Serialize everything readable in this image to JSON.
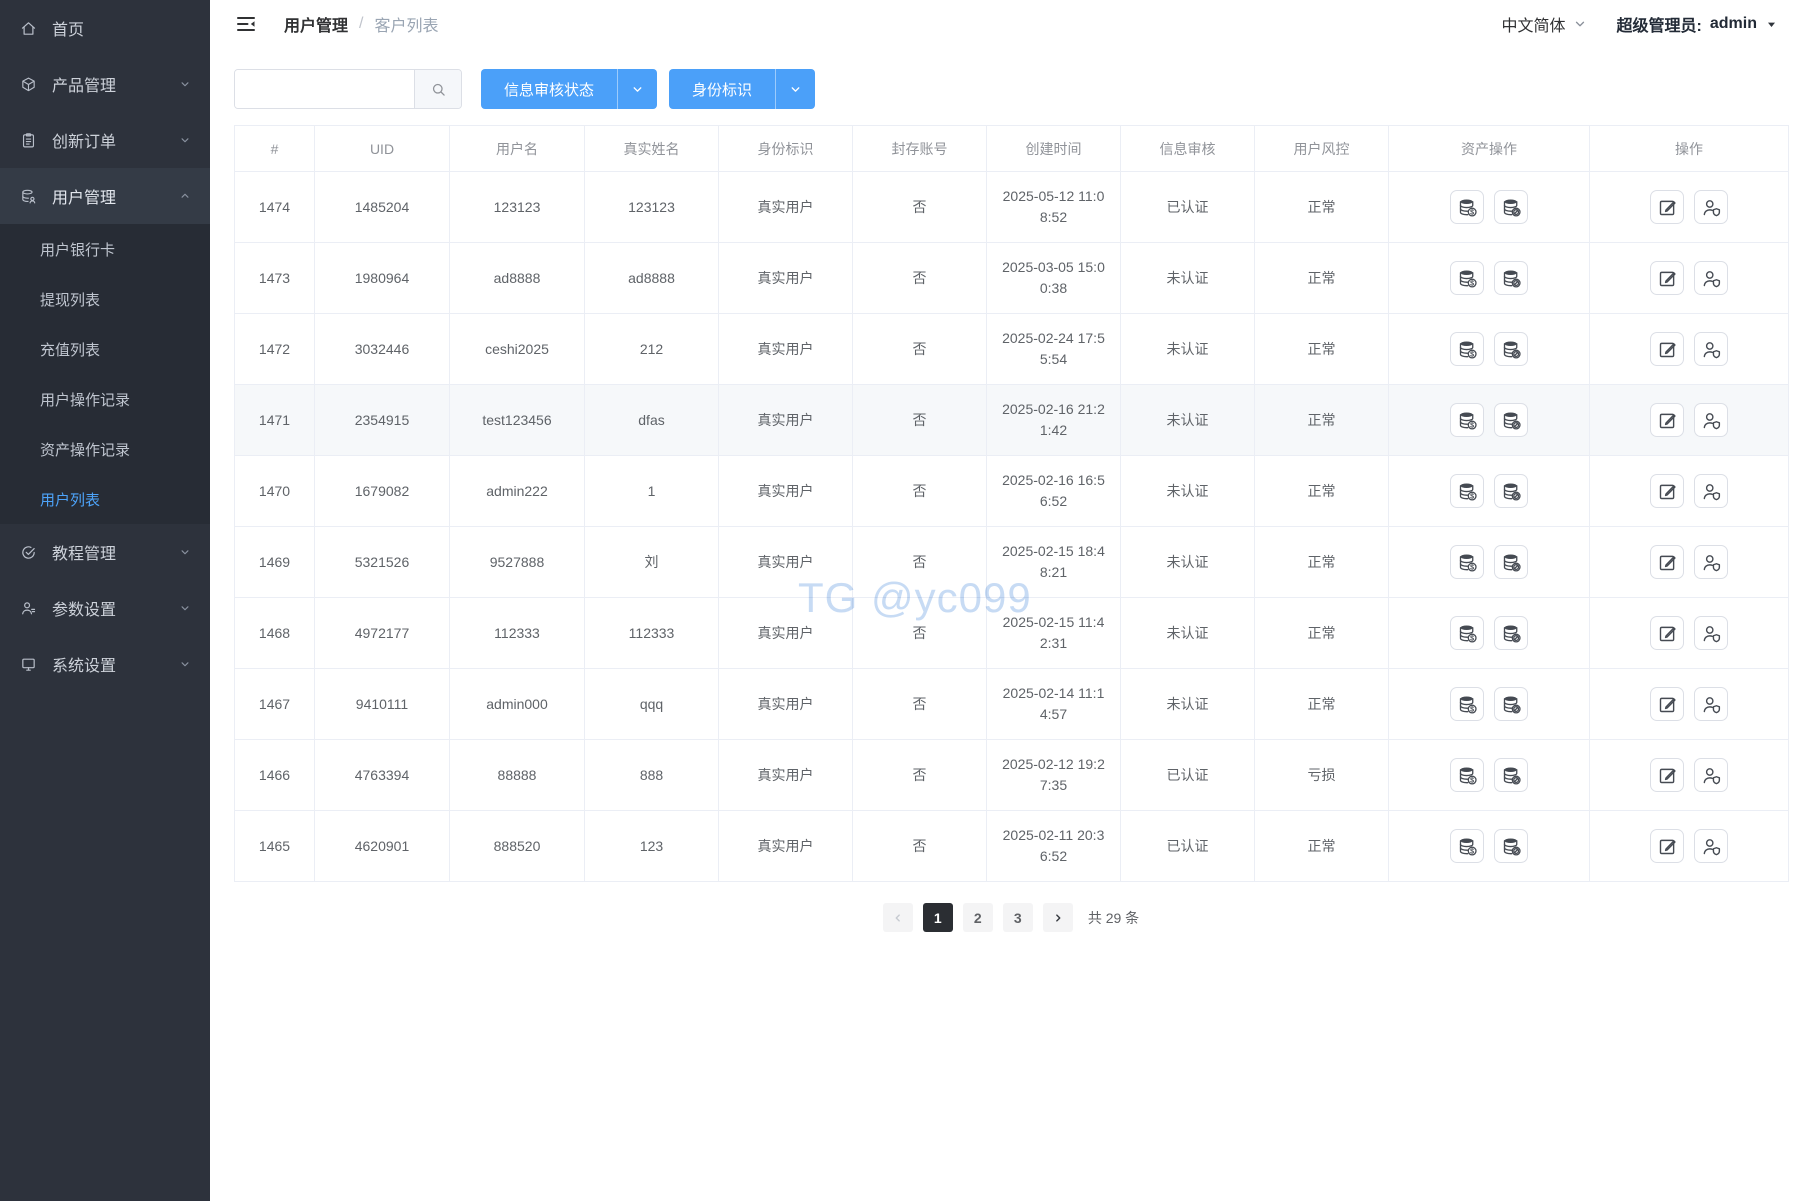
{
  "sidebar": {
    "items": [
      {
        "name": "home",
        "label": "首页",
        "icon": "home-icon",
        "chevron": null
      },
      {
        "name": "products",
        "label": "产品管理",
        "icon": "product-icon",
        "chevron": "down"
      },
      {
        "name": "innovation-orders",
        "label": "创新订单",
        "icon": "order-icon",
        "chevron": "down"
      },
      {
        "name": "user-management",
        "label": "用户管理",
        "icon": "users-icon",
        "chevron": "up",
        "expanded": true,
        "children": [
          {
            "name": "user-bank-cards",
            "label": "用户银行卡",
            "active": false
          },
          {
            "name": "withdraw-list",
            "label": "提现列表",
            "active": false
          },
          {
            "name": "recharge-list",
            "label": "充值列表",
            "active": false
          },
          {
            "name": "user-operation-records",
            "label": "用户操作记录",
            "active": false
          },
          {
            "name": "asset-operation-records",
            "label": "资产操作记录",
            "active": false
          },
          {
            "name": "user-list",
            "label": "用户列表",
            "active": true
          }
        ]
      },
      {
        "name": "tutorials",
        "label": "教程管理",
        "icon": "tutorial-icon",
        "chevron": "down"
      },
      {
        "name": "parameters",
        "label": "参数设置",
        "icon": "params-icon",
        "chevron": "down"
      },
      {
        "name": "system-settings",
        "label": "系统设置",
        "icon": "system-icon",
        "chevron": "down"
      }
    ]
  },
  "header": {
    "breadcrumb": [
      "用户管理",
      "客户列表"
    ],
    "language": "中文简体",
    "user_role_label": "超级管理员:",
    "username": "admin"
  },
  "toolbar": {
    "search_placeholder": "",
    "search_value": "",
    "filters": [
      {
        "label": "信息审核状态"
      },
      {
        "label": "身份标识"
      }
    ]
  },
  "table": {
    "columns": [
      "#",
      "UID",
      "用户名",
      "真实姓名",
      "身份标识",
      "封存账号",
      "创建时间",
      "信息审核",
      "用户风控",
      "资产操作",
      "操作"
    ],
    "asset_action_icons": [
      "coins-dollar-icon",
      "coins-ban-icon"
    ],
    "row_action_icons": [
      "edit-icon",
      "user-shield-icon"
    ],
    "rows": [
      {
        "id": "1474",
        "uid": "1485204",
        "username": "123123",
        "real_name": "123123",
        "identity": "真实用户",
        "sealed": "否",
        "created_at": "2025-05-12 11:08:52",
        "review": "已认证",
        "risk": "正常",
        "highlighted": false
      },
      {
        "id": "1473",
        "uid": "1980964",
        "username": "ad8888",
        "real_name": "ad8888",
        "identity": "真实用户",
        "sealed": "否",
        "created_at": "2025-03-05 15:00:38",
        "review": "未认证",
        "risk": "正常",
        "highlighted": false
      },
      {
        "id": "1472",
        "uid": "3032446",
        "username": "ceshi2025",
        "real_name": "212",
        "identity": "真实用户",
        "sealed": "否",
        "created_at": "2025-02-24 17:55:54",
        "review": "未认证",
        "risk": "正常",
        "highlighted": false
      },
      {
        "id": "1471",
        "uid": "2354915",
        "username": "test123456",
        "real_name": "dfas",
        "identity": "真实用户",
        "sealed": "否",
        "created_at": "2025-02-16 21:21:42",
        "review": "未认证",
        "risk": "正常",
        "highlighted": true
      },
      {
        "id": "1470",
        "uid": "1679082",
        "username": "admin222",
        "real_name": "1",
        "identity": "真实用户",
        "sealed": "否",
        "created_at": "2025-02-16 16:56:52",
        "review": "未认证",
        "risk": "正常",
        "highlighted": false
      },
      {
        "id": "1469",
        "uid": "5321526",
        "username": "9527888",
        "real_name": "刘",
        "identity": "真实用户",
        "sealed": "否",
        "created_at": "2025-02-15 18:48:21",
        "review": "未认证",
        "risk": "正常",
        "highlighted": false
      },
      {
        "id": "1468",
        "uid": "4972177",
        "username": "112333",
        "real_name": "112333",
        "identity": "真实用户",
        "sealed": "否",
        "created_at": "2025-02-15 11:42:31",
        "review": "未认证",
        "risk": "正常",
        "highlighted": false
      },
      {
        "id": "1467",
        "uid": "9410111",
        "username": "admin000",
        "real_name": "qqq",
        "identity": "真实用户",
        "sealed": "否",
        "created_at": "2025-02-14 11:14:57",
        "review": "未认证",
        "risk": "正常",
        "highlighted": false
      },
      {
        "id": "1466",
        "uid": "4763394",
        "username": "88888",
        "real_name": "888",
        "identity": "真实用户",
        "sealed": "否",
        "created_at": "2025-02-12 19:27:35",
        "review": "已认证",
        "risk": "亏损",
        "highlighted": false
      },
      {
        "id": "1465",
        "uid": "4620901",
        "username": "888520",
        "real_name": "123",
        "identity": "真实用户",
        "sealed": "否",
        "created_at": "2025-02-11 20:36:52",
        "review": "已认证",
        "risk": "正常",
        "highlighted": false
      }
    ]
  },
  "pagination": {
    "pages": [
      "1",
      "2",
      "3"
    ],
    "active_page": "1",
    "total_text": "共 29 条"
  },
  "watermark": "TG @yc099",
  "colors": {
    "primary_button": "#4ba0f9",
    "sidebar_bg": "#2d323c",
    "active_link": "#4da3f9",
    "pagination_active_bg": "#2b2e33",
    "watermark": "#c7dbf4"
  }
}
